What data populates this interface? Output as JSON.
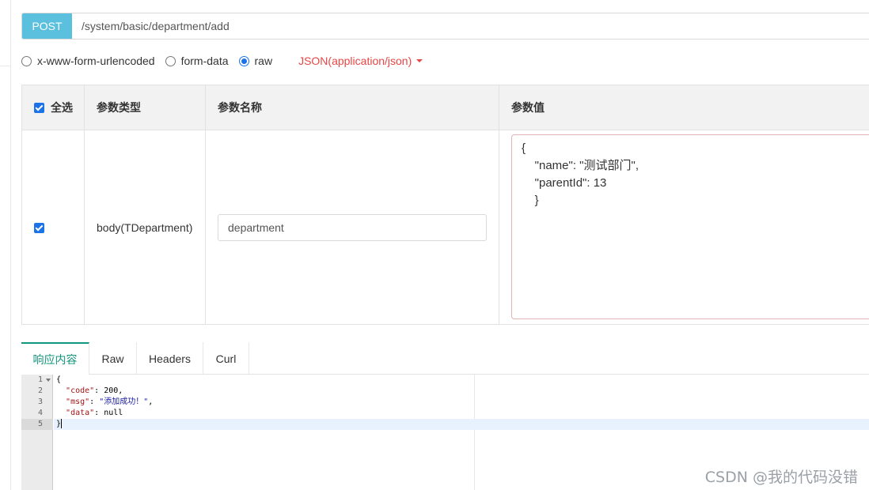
{
  "request": {
    "method": "POST",
    "url": "/system/basic/department/add"
  },
  "body_types": {
    "options": [
      "x-www-form-urlencoded",
      "form-data",
      "raw"
    ],
    "selected": "raw",
    "content_type": "JSON(application/json)"
  },
  "param_table": {
    "headers": {
      "select_all": "全选",
      "param_type": "参数类型",
      "param_name": "参数名称",
      "param_value": "参数值"
    },
    "row": {
      "checked": true,
      "type": "body(TDepartment)",
      "name": "department",
      "value": "{\n    \"name\": \"测试部门\",\n    \"parentId\": 13\n    }"
    }
  },
  "response_tabs": [
    "响应内容",
    "Raw",
    "Headers",
    "Curl"
  ],
  "active_tab": "响应内容",
  "editor": {
    "line_numbers": [
      "1",
      "2",
      "3",
      "4",
      "5"
    ],
    "active_line": 5,
    "lines": {
      "open": "{",
      "code_key": "\"code\"",
      "code_val": "200",
      "msg_key": "\"msg\"",
      "msg_val": "\"添加成功！\"",
      "data_key": "\"data\"",
      "data_val": "null",
      "close": "}"
    }
  },
  "watermark": "CSDN @我的代码没错",
  "colors": {
    "method_bg": "#5bc0de",
    "accent_tab": "#14967d",
    "content_type": "#e84545",
    "checkbox": "#1a73e8"
  }
}
